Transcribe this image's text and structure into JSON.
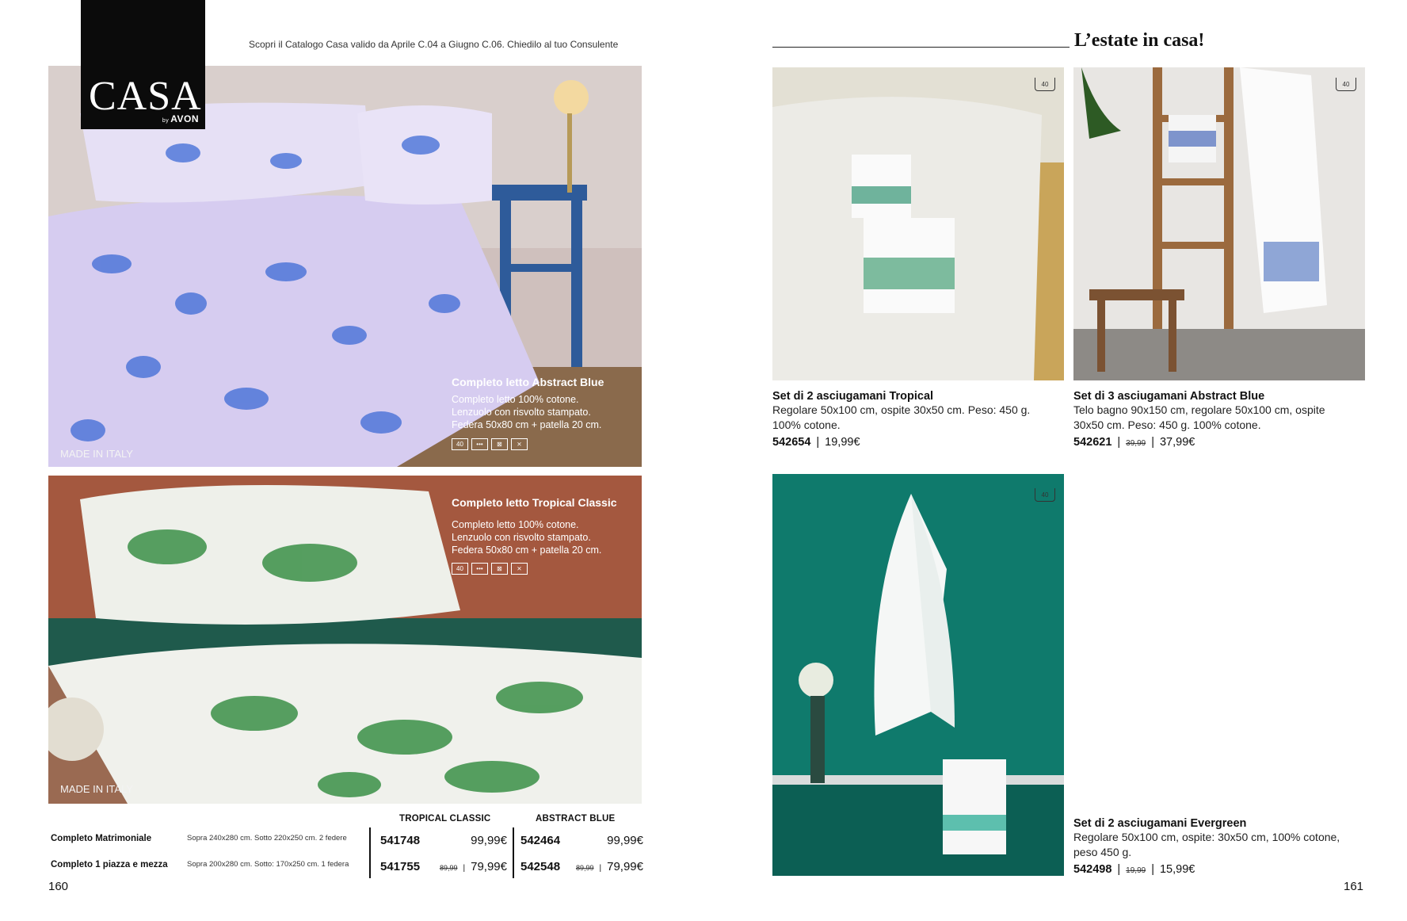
{
  "brand": {
    "logo": "CASA",
    "by": "by",
    "sub": "AVON"
  },
  "catalog_note": "Scopri il Catalogo Casa valido da Aprile C.04 a Giugno C.06. Chiedilo al tuo Consulente",
  "title": "L’estate in casa!",
  "left": {
    "abstract": {
      "title": "Completo letto Abstract Blue",
      "lines": [
        "Completo letto 100% cotone.",
        "Lenzuolo con risvolto stampato.",
        "Federa 50x80 cm + patella 20 cm."
      ],
      "made": "MADE IN ITALY",
      "care": [
        "40",
        "•••",
        "⊠",
        "⨯"
      ]
    },
    "tropical": {
      "title": "Completo letto Tropical Classic",
      "lines": [
        "Completo letto 100% cotone.",
        "Lenzuolo con risvolto stampato.",
        "Federa 50x80 cm + patella 20 cm."
      ],
      "made": "MADE IN ITALY",
      "care": [
        "40",
        "•••",
        "⊠",
        "⨯"
      ]
    },
    "table": {
      "headers": [
        "TROPICAL CLASSIC",
        "ABSTRACT BLUE"
      ],
      "rows": [
        {
          "label": "Completo Matrimoniale",
          "dims": "Sopra 240x280 cm. Sotto 220x250 cm. 2 federe",
          "tc_code": "541748",
          "tc_old": "",
          "tc_price": "99,99€",
          "ab_code": "542464",
          "ab_old": "",
          "ab_price": "99,99€"
        },
        {
          "label": "Completo 1 piazza e mezza",
          "dims": "Sopra 200x280 cm. Sotto: 170x250 cm. 1 federa",
          "tc_code": "541755",
          "tc_old": "89,99",
          "tc_price": "79,99€",
          "ab_code": "542548",
          "ab_old": "89,99",
          "ab_price": "79,99€"
        }
      ]
    },
    "page": "160"
  },
  "right": {
    "wash": "40",
    "products": [
      {
        "title": "Set di 2 asciugamani Tropical",
        "desc1": "Regolare 50x100 cm, ospite 30x50 cm. Peso: 450 g.",
        "desc2": "100% cotone.",
        "code": "542654",
        "old": "",
        "price": "19,99€"
      },
      {
        "title": "Set di 3 asciugamani Abstract Blue",
        "desc1": "Telo bagno 90x150 cm, regolare 50x100 cm, ospite",
        "desc2": "30x50 cm. Peso: 450 g. 100% cotone.",
        "code": "542621",
        "old": "39,99",
        "price": "37,99€"
      },
      {
        "title": "Set di 2 asciugamani Evergreen",
        "desc1": "Regolare 50x100 cm, ospite: 30x50 cm, 100% cotone,",
        "desc2": "peso 450 g.",
        "code": "542498",
        "old": "19,99",
        "price": "15,99€"
      }
    ],
    "page": "161"
  }
}
